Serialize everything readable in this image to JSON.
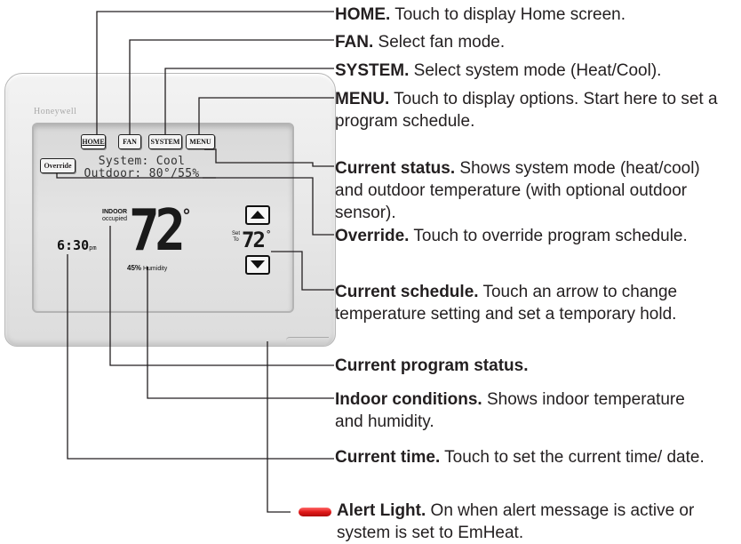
{
  "device": {
    "brand": "Honeywell",
    "buttons": {
      "home": "HOME",
      "fan": "FAN",
      "system": "SYSTEM",
      "menu": "MENU"
    },
    "override": "Override",
    "status_line1": "System: Cool",
    "status_line2": "Outdoor: 80°/55%",
    "indoor_label": "INDOOR",
    "occupied_label": "occupied",
    "indoor_temp": "72",
    "humidity_value": "45",
    "humidity_unit": "%",
    "humidity_label": "Humidity",
    "time": "6:30",
    "time_suffix": "pm",
    "set_label_1": "Set",
    "set_label_2": "To",
    "set_temp": "72",
    "degree": "°"
  },
  "callouts": [
    {
      "title": "HOME.",
      "text": " Touch to display Home screen."
    },
    {
      "title": "FAN.",
      "text": " Select fan mode."
    },
    {
      "title": "SYSTEM.",
      "text": " Select system mode (Heat/Cool)."
    },
    {
      "title": "MENU.",
      "text": " Touch to display options. Start here to set a program schedule."
    },
    {
      "title": "Current status.",
      "text": " Shows system mode (heat/cool) and outdoor temperature (with optional outdoor sensor)."
    },
    {
      "title": "Override.",
      "text": " Touch to override program schedule."
    },
    {
      "title": "Current schedule.",
      "text": " Touch an arrow to change temperature setting and set a temporary hold."
    },
    {
      "title": "Current program status.",
      "text": ""
    },
    {
      "title": "Indoor conditions.",
      "text": " Shows indoor temperature and humidity."
    },
    {
      "title": "Current time.",
      "text": " Touch to set the current time/ date."
    },
    {
      "title": "Alert Light.",
      "text": " On when alert message is active or system is set to EmHeat."
    }
  ],
  "colors": {
    "alert_light": "#e01818",
    "line": "#231f20"
  }
}
